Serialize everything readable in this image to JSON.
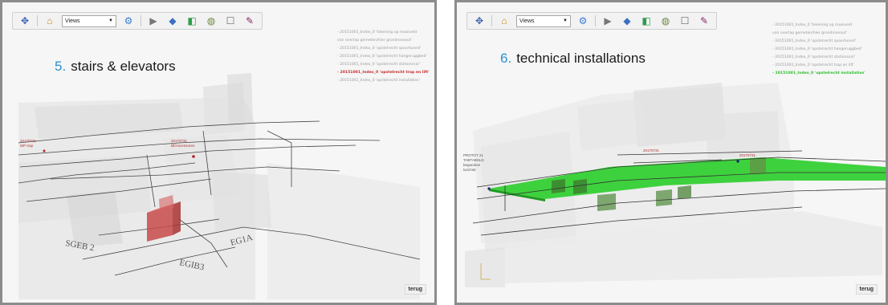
{
  "colors": {
    "title_number": "#2b8fcf",
    "active_layer_red": "#c72e2e",
    "active_layer_green": "#2fbf2f",
    "slide_border": "#8c8c8c"
  },
  "toolbar": {
    "views_label": "Views",
    "icons": [
      "navigate-icon",
      "home-icon",
      "views-select",
      "settings-icon",
      "play-icon",
      "box-icon",
      "layers-icon",
      "globe-icon",
      "checkbox-icon",
      "paint-icon"
    ]
  },
  "slides": [
    {
      "number": "5.",
      "title": "stairs & elevators",
      "layers": [
        "- 20151001_Index_0 'tekening op maaiveld",
        "  van overlap gemeten/hier grondniveaut'",
        "- 20151001_Index_0 'opstelrecht spoortuned'",
        "- 20151001_Index_0 'opstelrecht hangeruggbed'",
        "- 20151001_Index_0 'opstelrecht stationsval'",
        "- 20151001_Index_0 'opstelrecht trap en lift'",
        "- 20151001_Index_0 'opstelrecht installaties'"
      ],
      "active_layer": 5,
      "back_label": "terug"
    },
    {
      "number": "6.",
      "title": "technical installations",
      "layers": [
        "- 20151001_Index_0 'tekening op maaiveld",
        "  van overlap gemeten/hier grondniveaut'",
        "- 20151001_Index_0 'opstelrecht spoortuned'",
        "- 20151001_Index_0 'opstelrecht hangeruggbed'",
        "- 20151001_Index_0 'opstelrecht stationsval'",
        "- 20151001_Index_0 'opstelrecht trap en lift'",
        "- 20151001_Index_0 'opstelrecht installaties'"
      ],
      "active_layer": 6,
      "back_label": "terug"
    }
  ]
}
